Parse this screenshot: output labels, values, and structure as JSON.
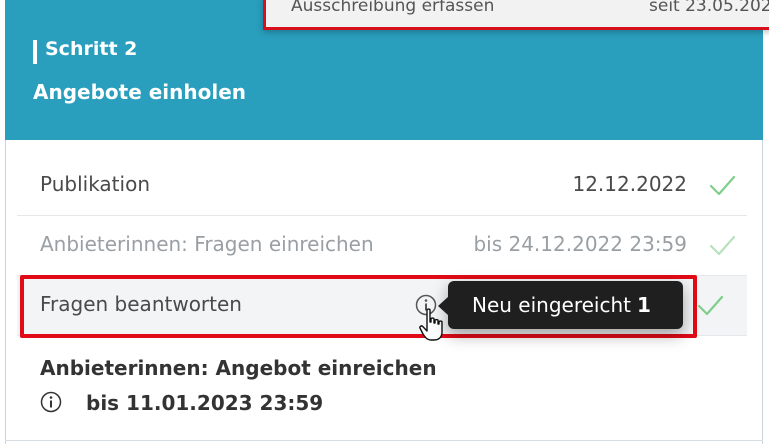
{
  "overlay": {
    "left_text": "Ausschreibung erfassen",
    "right_text": "seit 23.05.202"
  },
  "step": {
    "label": "Schritt 2",
    "title": "Angebote einholen"
  },
  "rows": [
    {
      "label": "Publikation",
      "date": "12.12.2022",
      "status": "done"
    },
    {
      "label": "Anbieterinnen: Fragen einreichen",
      "date": "bis 24.12.2022 23:59",
      "status": "done"
    },
    {
      "label": "Fragen beantworten",
      "status": "done"
    }
  ],
  "tooltip": {
    "text": "Neu eingereicht",
    "count": "1"
  },
  "next": {
    "title": "Anbieterinnen: Angebot einreichen",
    "deadline": "bis 11.01.2023 23:59"
  },
  "colors": {
    "header": "#299ebd",
    "highlight": "#e10b17",
    "check": "#7fce8a",
    "check_muted": "#b7e2bd"
  },
  "icons": {
    "status": "check-icon",
    "info": "info-icon",
    "cursor": "hand-pointer-icon"
  }
}
